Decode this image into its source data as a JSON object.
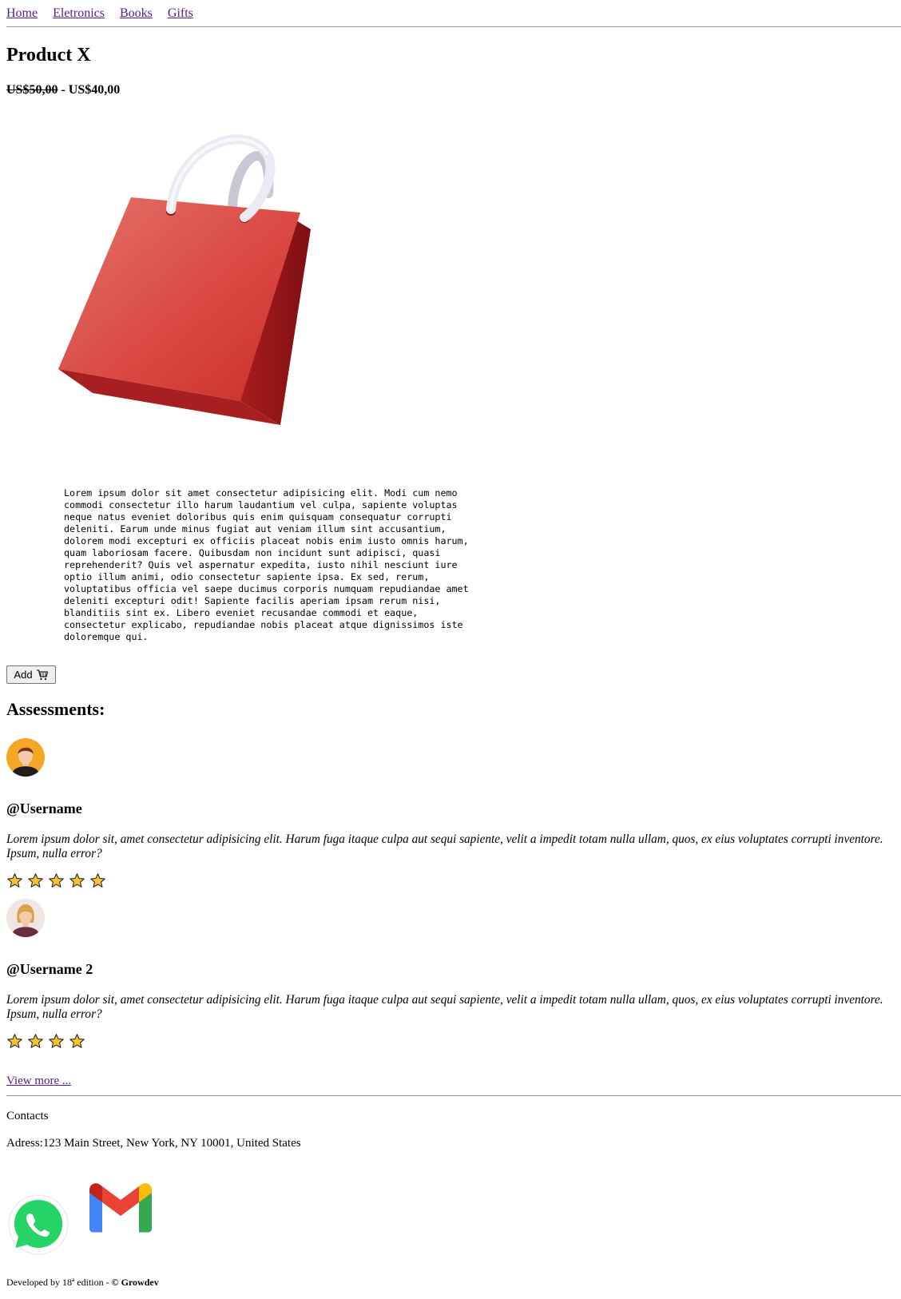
{
  "nav": {
    "links": [
      "Home",
      "Eletronics",
      "Books",
      "Gifts"
    ]
  },
  "product": {
    "title": "Product X",
    "old_price": "US$50,00",
    "price_separator": " - ",
    "price": "US$40,00",
    "image_icon": "red-shopping-bag",
    "description": "Lorem ipsum dolor sit amet consectetur adipisicing elit. Modi cum nemo commodi consectetur illo harum laudantium vel culpa, sapiente voluptas neque natus eveniet doloribus quis enim quisquam consequatur corrupti deleniti. Earum unde minus fugiat aut veniam illum sint accusantium, dolorem modi excepturi ex officiis placeat nobis enim iusto omnis harum, quam laboriosam facere. Quibusdam non incidunt sunt adipisci, quasi reprehenderit? Quis vel aspernatur expedita, iusto nihil nesciunt iure optio illum animi, odio consectetur sapiente ipsa. Ex sed, rerum, voluptatibus officia vel saepe ducimus corporis numquam repudiandae amet deleniti excepturi odit! Sapiente facilis aperiam ipsam rerum nisi, blanditiis sint ex. Libero eveniet recusandae commodi et eaque, consectetur explicabo, repudiandae nobis placeat atque dignissimos iste doloremque qui.",
    "add_label": "Add",
    "add_icon": "cart-icon"
  },
  "assessments": {
    "title": "Assessments:",
    "reviews": [
      {
        "username": "@Username",
        "comment": "Lorem ipsum dolor sit, amet consectetur adipisicing elit. Harum fuga itaque culpa aut sequi sapiente, velit a impedit totam nulla ullam, quos, ex eius voluptates corrupti inventore. Ipsum, nulla error?",
        "rating": 5,
        "avatar": "male-avatar"
      },
      {
        "username": "@Username 2",
        "comment": "Lorem ipsum dolor sit, amet consectetur adipisicing elit. Harum fuga itaque culpa aut sequi sapiente, velit a impedit totam nulla ullam, quos, ex eius voluptates corrupti inventore. Ipsum, nulla error?",
        "rating": 4,
        "avatar": "female-avatar"
      }
    ],
    "view_more": "View more ..."
  },
  "contacts": {
    "label": "Contacts",
    "address": "Adress:123 Main Street, New York, NY 10001, United States",
    "icons": [
      "whatsapp-icon",
      "gmail-icon"
    ]
  },
  "footer": {
    "prefix": "Developed by 18ª edition - ",
    "brand": "© Growdev"
  },
  "colors": {
    "link": "#551a8b",
    "bag": "#d9453f",
    "star": "#f6c232"
  }
}
